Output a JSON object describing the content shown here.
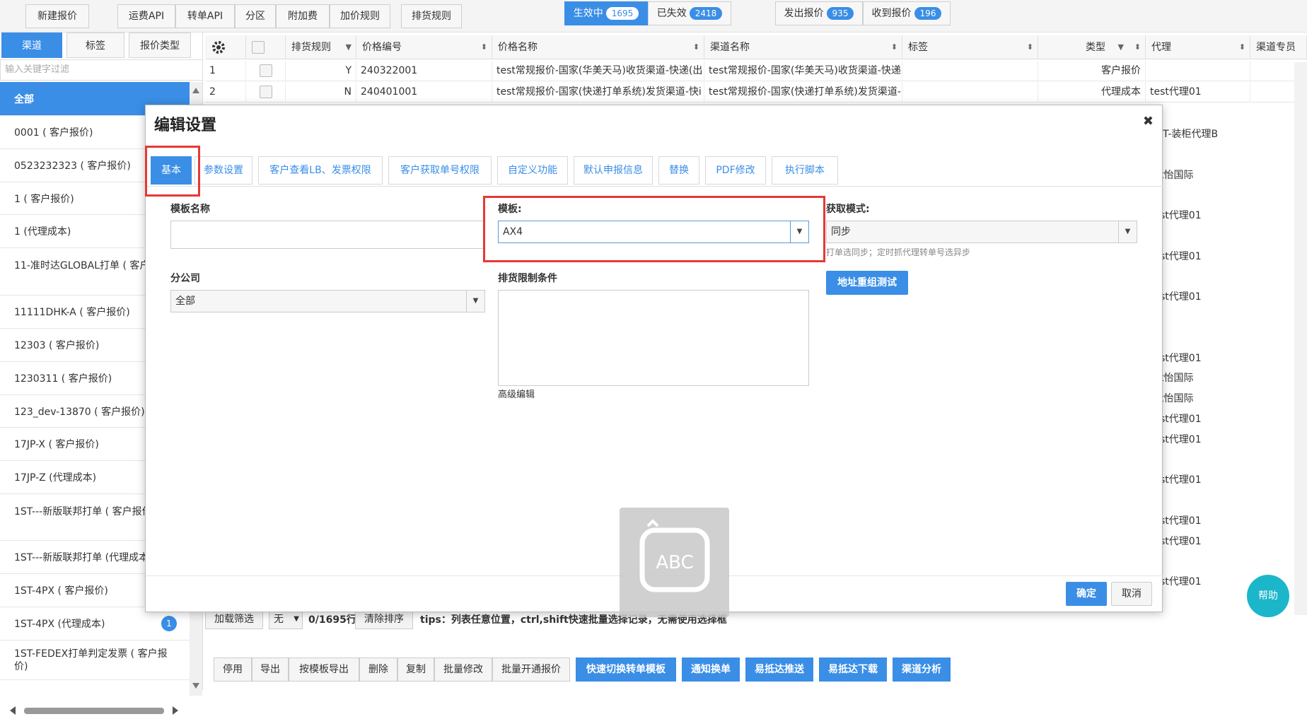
{
  "toolbar": {
    "new_quote": "新建报价",
    "group1": [
      "运费API",
      "转单API",
      "分区",
      "附加费",
      "加价规则"
    ],
    "shipping_rules": "排货规则",
    "active_label": "生效中",
    "active_count": "1695",
    "expired_label": "已失效",
    "expired_count": "2418",
    "sent_label": "发出报价",
    "sent_count": "935",
    "received_label": "收到报价",
    "received_count": "196"
  },
  "left": {
    "tabs": [
      "渠道",
      "标签",
      "报价类型"
    ],
    "filter_placeholder": "输入关键字过滤",
    "items": [
      {
        "label": "全部"
      },
      {
        "label": "0001 ( 客户报价)"
      },
      {
        "label": "0523232323 ( 客户报价)"
      },
      {
        "label": "1 ( 客户报价)"
      },
      {
        "label": "1 (代理成本)"
      },
      {
        "label": "11-准时达GLOBAL打单 ( 客户"
      },
      {
        "label": "11111DHK-A ( 客户报价)"
      },
      {
        "label": "12303 ( 客户报价)"
      },
      {
        "label": "1230311 ( 客户报价)"
      },
      {
        "label": "123_dev-13870 ( 客户报价)"
      },
      {
        "label": "17JP-X ( 客户报价)"
      },
      {
        "label": "17JP-Z (代理成本)"
      },
      {
        "label": "1ST---新版联邦打单 ( 客户报价"
      },
      {
        "label": "1ST---新版联邦打单 (代理成本"
      },
      {
        "label": "1ST-4PX ( 客户报价)"
      },
      {
        "label": "1ST-4PX (代理成本)",
        "count": "1"
      },
      {
        "label": "1ST-FEDEX打单判定发票 ( 客户报价)"
      }
    ]
  },
  "grid": {
    "headers": [
      "排货规则",
      "价格编号",
      "价格名称",
      "渠道名称",
      "标签",
      "类型",
      "代理",
      "渠道专员"
    ],
    "rows": [
      {
        "no": "1",
        "rule": "Y",
        "code": "240322001",
        "name": "test常规报价-国家(华美天马)收货渠道-快递(出",
        "channel": "test常规报价-国家(华美天马)收货渠道-快递",
        "type": "客户报价",
        "agent": ""
      },
      {
        "no": "2",
        "rule": "N",
        "code": "240401001",
        "name": "test常规报价-国家(快递打单系统)发货渠道-快i",
        "channel": "test常规报价-国家(快递打单系统)发货渠道-",
        "type": "代理成本",
        "agent": "test代理01"
      }
    ],
    "right_texts": [
      "JT-装柜代理B",
      "t怡国际",
      "st代理01",
      "st代理01",
      "st代理01",
      "st代理01",
      "t怡国际",
      "t怡国际",
      "st代理01",
      "st代理01",
      "st代理01",
      "st代理01",
      "st代理01",
      "st代理01"
    ]
  },
  "footer": {
    "load_filter": "加载筛选",
    "none": "无",
    "row_count": "0/1695行",
    "clear_sort": "清除排序",
    "tips": "tips：列表任意位置，ctrl,shift快速批量选择记录，无需使用选择框"
  },
  "bottom": {
    "grey": [
      "停用",
      "导出",
      "按模板导出",
      "删除",
      "复制",
      "批量修改",
      "批量开通报价"
    ],
    "blue": [
      "快速切换转单模板",
      "通知换单",
      "易抵达推送",
      "易抵达下载",
      "渠道分析"
    ]
  },
  "help": "帮助",
  "modal": {
    "title": "编辑设置",
    "tabs": [
      "基本",
      "参数设置",
      "客户查看LB、发票权限",
      "客户获取单号权限",
      "自定义功能",
      "默认申报信息",
      "替换",
      "PDF修改",
      "执行脚本"
    ],
    "template_name_label": "模板名称",
    "template_name_value": "",
    "template_label": "模板:",
    "template_value": "AX4",
    "fetch_mode_label": "获取模式:",
    "fetch_mode_value": "同步",
    "fetch_mode_hint": "打单选同步；定时抓代理转单号选异步",
    "branch_label": "分公司",
    "branch_value": "全部",
    "restrict_label": "排货限制条件",
    "advanced_edit": "高级编辑",
    "address_test": "地址重组测试",
    "confirm": "确定",
    "cancel": "取消"
  },
  "ime": {
    "text": "ABC"
  }
}
